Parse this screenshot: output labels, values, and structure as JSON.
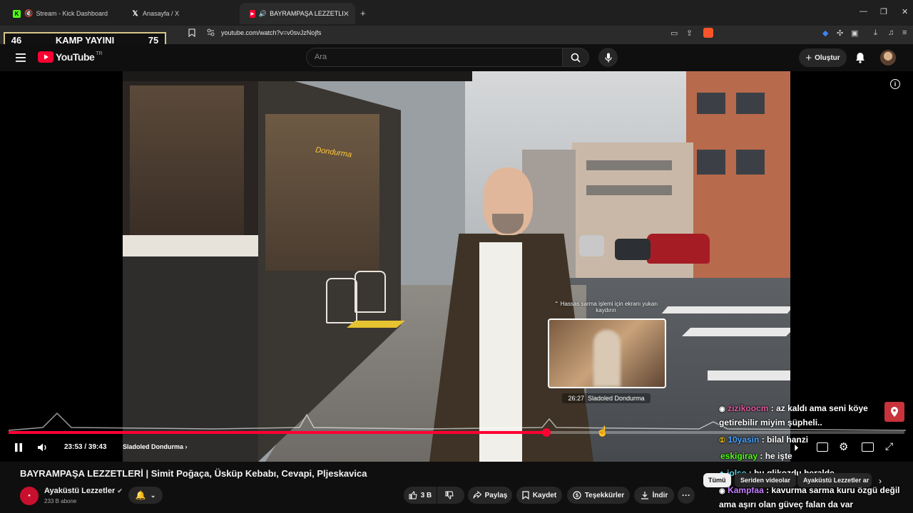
{
  "browser": {
    "tabs": [
      {
        "label": "Stream - Kick Dashboard",
        "icon": "kick-icon",
        "active": false
      },
      {
        "label": "Anasayfa / X",
        "icon": "x-icon",
        "active": false
      },
      {
        "label": "BAYRAMPAŞA LEZZETLERİ | Simit",
        "icon": "youtube-icon",
        "active": true
      }
    ],
    "url": "youtube.com/watch?v=v0svJzNojfs"
  },
  "stream_overlay": {
    "left_count": "46",
    "title": "KAMP YAYINI",
    "right_count": "75"
  },
  "youtube": {
    "logo_text": "YouTube",
    "region": "TR",
    "search_placeholder": "Ara",
    "create_label": "Oluştur"
  },
  "player": {
    "current_time": "23:53",
    "duration": "39:43",
    "time_separator": "/",
    "chapter": "Sladoled Dondurma",
    "progress": 0.6,
    "preview_time": "26:27",
    "preview_chapter": "Sladoled Dondurma",
    "hint_text_1": "Hassas sarma işlemi için ekranı yukarı",
    "hint_text_2": "kaydırın",
    "shop_sign": "Dondurma"
  },
  "chat": [
    {
      "user": "zizikoocm",
      "message": "az kaldı ama seni köye",
      "color": "#e05aa0"
    },
    {
      "user": "",
      "message": "getirebilir miyim şüpheli..",
      "color": "#ffffff"
    },
    {
      "user": "10yasin",
      "message": "bilal hanzi",
      "color": "#4aa3ff"
    },
    {
      "user": "eskigiray",
      "message": "he işte",
      "color": "#53fc18"
    },
    {
      "user": "jolse",
      "message": "bu glikozdu heralde",
      "color": "#5ad2e0"
    },
    {
      "user": "Kampfaa",
      "message": "kavurma sarma kuru özgü değil",
      "color": "#c77dff"
    },
    {
      "user": "",
      "message": "ama aşırı olan güveç falan da var",
      "color": "#ffffff"
    }
  ],
  "video": {
    "title": "BAYRAMPAŞA LEZZETLERİ | Simit Poğaça, Üsküp Kebabı, Cevapi, Pljeskavica",
    "channel": "Ayaküstü Lezzetler",
    "subscribers": "233 B abone",
    "likes": "3 B",
    "share_label": "Paylaş",
    "save_label": "Kaydet",
    "thanks_label": "Teşekkürler",
    "download_label": "İndir"
  },
  "filter_chips": [
    "Tümü",
    "Seriden videolar",
    "Ayaküstü Lezzetler ar"
  ],
  "colors": {
    "accent_red": "#ff0033",
    "kick_green": "#53fc18"
  }
}
